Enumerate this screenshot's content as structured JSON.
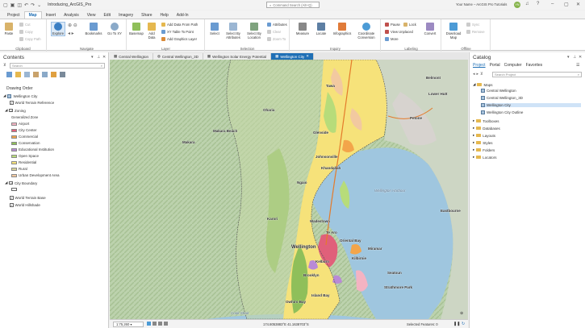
{
  "app": {
    "title": "Introducing_ArcGIS_Pro",
    "search_placeholder": "Command Search (Alt+Q)",
    "user": "Your Name – ArcGIS Pro Tutorials",
    "avatar_initials": "YN"
  },
  "ribbon_tabs": [
    "Project",
    "Map",
    "Insert",
    "Analysis",
    "View",
    "Edit",
    "Imagery",
    "Share",
    "Help",
    "Add-In"
  ],
  "ribbon": {
    "clipboard": {
      "label": "Clipboard",
      "paste": "Paste",
      "cut": "Cut",
      "copy": "Copy",
      "copy_path": "Copy Path"
    },
    "navigate": {
      "label": "Navigate",
      "explore": "Explore",
      "bookmarks": "Bookmarks",
      "goto": "Go To XY"
    },
    "layer": {
      "label": "Layer",
      "basemap": "Basemap",
      "add_data": "Add Data",
      "add_data_from_path": "Add Data From Path",
      "xy_table": "XY Table To Point",
      "add_graphics": "Add Graphics Layer"
    },
    "selection": {
      "label": "Selection",
      "select": "Select",
      "by_attributes": "Select By Attributes",
      "by_location": "Select By Location",
      "attributes": "Attributes",
      "clear": "Clear",
      "zoom_to": "Zoom To"
    },
    "inquiry": {
      "label": "Inquiry",
      "measure": "Measure",
      "locate": "Locate",
      "infographics": "Infographics",
      "coord": "Coordinate Conversion"
    },
    "labeling": {
      "label": "Labeling",
      "pause": "Pause",
      "lock": "Lock",
      "view_unplaced": "View Unplaced",
      "more": "More",
      "convert": "Convert"
    },
    "offline": {
      "label": "Offline",
      "download": "Download Map",
      "sync": "Sync",
      "remove": "Remove"
    }
  },
  "contents": {
    "title": "Contents",
    "search_placeholder": "Search",
    "drawing_order": "Drawing Order",
    "map_name": "Wellington City",
    "layers": {
      "terrain_ref": "World Terrain Reference",
      "zoning": "Zoning",
      "generalized_zone": "Generalized Zone",
      "zone_classes": [
        {
          "name": "Airport",
          "color": "#f4b3c2"
        },
        {
          "name": "City Center",
          "color": "#e0607a"
        },
        {
          "name": "Commercial",
          "color": "#f3a54a"
        },
        {
          "name": "Conservation",
          "color": "#8fbf5a"
        },
        {
          "name": "Educational Institution",
          "color": "#b98ad6"
        },
        {
          "name": "Open Space",
          "color": "#b7dc7a"
        },
        {
          "name": "Residential",
          "color": "#f6e27a"
        },
        {
          "name": "Rural",
          "color": "#d8d39a"
        },
        {
          "name": "Urban Development Area",
          "color": "#f2c9a0"
        }
      ],
      "city_boundary": "City Boundary",
      "terrain_base": "World Terrain Base",
      "hillshade": "World Hillshade"
    }
  },
  "map_tabs": [
    "Central Wellington",
    "Central Wellington_3D",
    "Wellington Solar Energy Potential",
    "Wellington City"
  ],
  "map": {
    "places": [
      "Makara Beach",
      "Makara",
      "Ohariu",
      "Johnsonville",
      "Glenside",
      "Tawa",
      "Khandallah",
      "Ngaio",
      "Karori",
      "Wellington",
      "Kelburn",
      "Brooklyn",
      "Island Bay",
      "Miramar",
      "Seatoun",
      "Petone",
      "Lower Hutt",
      "Eastbourne",
      "Belmont",
      "Oriental Bay",
      "Wadestown",
      "Kilbirnie",
      "Strathmore Park",
      "Owhiro Bay",
      "Te Aro"
    ],
    "water_labels": [
      "Wellington Harbour",
      "Cook Strait"
    ]
  },
  "status": {
    "scale": "1:75,260",
    "coords": "174.8053883°E 41.1638703°S",
    "selected": "Selected Features: 0"
  },
  "catalog": {
    "title": "Catalog",
    "tabs": [
      "Project",
      "Portal",
      "Computer",
      "Favorites"
    ],
    "search_placeholder": "Search Project",
    "maps_folder": "Maps",
    "maps": [
      "Central Wellington",
      "Central Wellington_3D",
      "Wellington City",
      "Wellington City Outline"
    ],
    "folders": [
      "Toolboxes",
      "Databases",
      "Layouts",
      "Styles",
      "Folders",
      "Locators"
    ]
  },
  "colors": {
    "accent": "#1f6fb5"
  }
}
